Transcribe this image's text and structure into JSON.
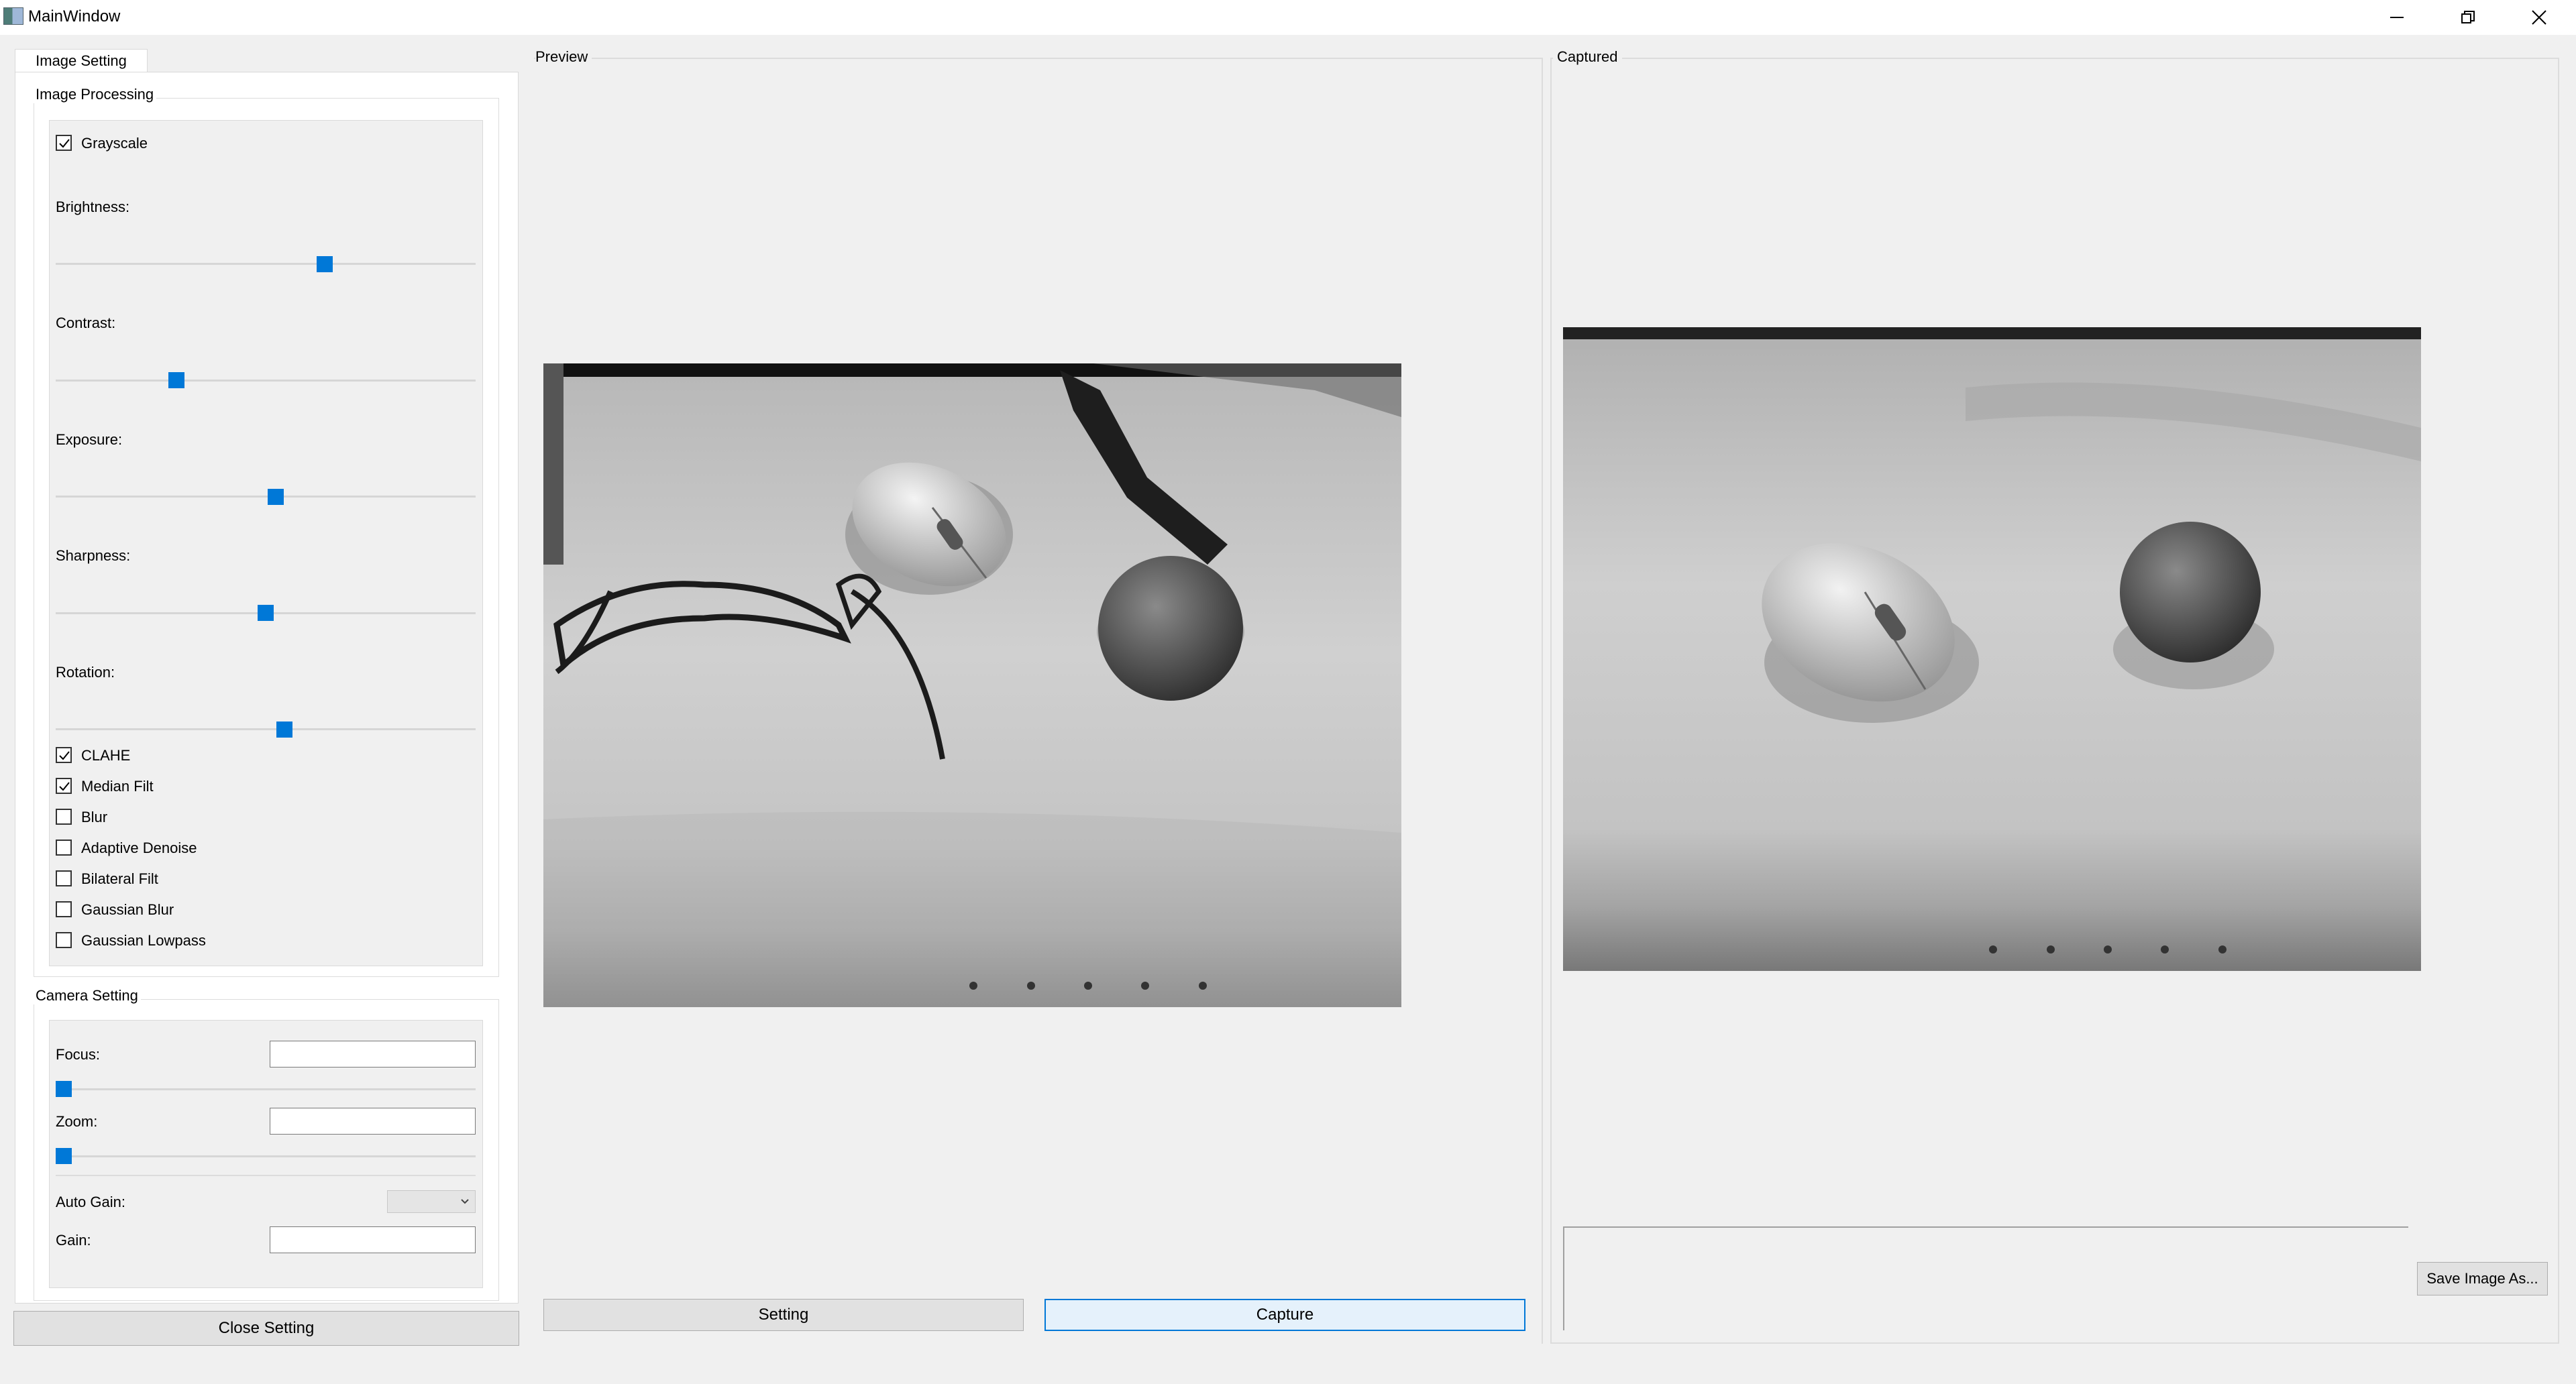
{
  "window": {
    "title": "MainWindow"
  },
  "tabs": [
    {
      "label": "Image Setting"
    }
  ],
  "image_processing": {
    "title": "Image Processing",
    "grayscale": {
      "label": "Grayscale",
      "checked": true
    },
    "sliders": [
      {
        "label": "Brightness:",
        "value": 0.64
      },
      {
        "label": "Contrast:",
        "value": 0.29
      },
      {
        "label": "Exposure:",
        "value": 0.53
      },
      {
        "label": "Sharpness:",
        "value": 0.5
      },
      {
        "label": "Rotation:",
        "value": 0.55
      }
    ],
    "filters": [
      {
        "label": "CLAHE",
        "checked": true
      },
      {
        "label": "Median Filt",
        "checked": true
      },
      {
        "label": "Blur",
        "checked": false
      },
      {
        "label": "Adaptive Denoise",
        "checked": false
      },
      {
        "label": "Bilateral Filt",
        "checked": false
      },
      {
        "label": "Gaussian Blur",
        "checked": false
      },
      {
        "label": "Gaussian Lowpass",
        "checked": false
      }
    ]
  },
  "camera_setting": {
    "title": "Camera Setting",
    "focus_label": "Focus:",
    "focus_value": "",
    "zoom_label": "Zoom:",
    "zoom_value": "",
    "auto_gain_label": "Auto Gain:",
    "auto_gain_value": "",
    "gain_label": "Gain:",
    "gain_value": ""
  },
  "buttons": {
    "close_setting": "Close Setting",
    "setting": "Setting",
    "capture": "Capture",
    "save_image": "Save Image As..."
  },
  "preview": {
    "title": "Preview"
  },
  "captured": {
    "title": "Captured",
    "text": ""
  },
  "colors": {
    "accent": "#0078d7",
    "background": "#f0f0f0"
  }
}
